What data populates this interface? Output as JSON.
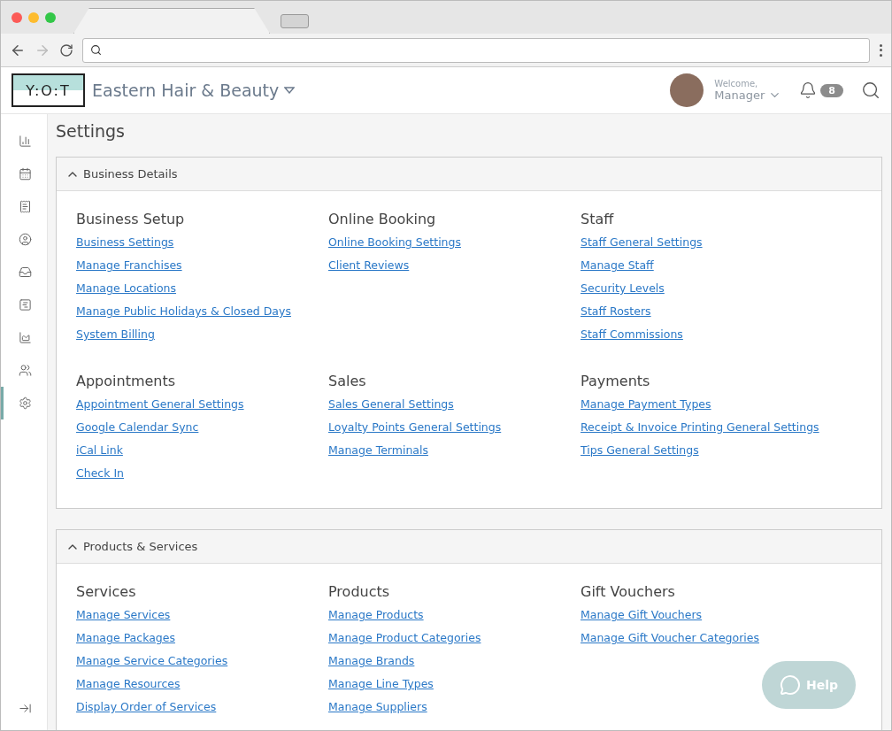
{
  "header": {
    "logo": "Y:O:T",
    "business": "Eastern Hair & Beauty",
    "welcome": "Welcome,",
    "user": "Manager",
    "notifications": "8"
  },
  "sidebar": {
    "items": [
      {
        "selected": false
      },
      {
        "selected": false
      },
      {
        "selected": false
      },
      {
        "selected": false
      },
      {
        "selected": false
      },
      {
        "selected": false
      },
      {
        "selected": false
      },
      {
        "selected": false
      },
      {
        "selected": true
      }
    ]
  },
  "page_title": "Settings",
  "sections": [
    {
      "title": "Business Details",
      "expanded": true,
      "groups": [
        {
          "heading": "Business Setup",
          "links": [
            "Business Settings",
            "Manage Franchises",
            "Manage Locations",
            "Manage Public Holidays & Closed Days",
            "System Billing"
          ]
        },
        {
          "heading": "Online Booking",
          "links": [
            "Online Booking Settings",
            "Client Reviews"
          ]
        },
        {
          "heading": "Staff",
          "links": [
            "Staff General Settings",
            "Manage Staff",
            "Security Levels",
            "Staff Rosters",
            "Staff Commissions"
          ]
        },
        {
          "heading": "Appointments",
          "links": [
            "Appointment General Settings",
            "Google Calendar Sync",
            "iCal Link",
            "Check In"
          ]
        },
        {
          "heading": "Sales",
          "links": [
            "Sales General Settings",
            "Loyalty Points General Settings",
            "Manage Terminals"
          ]
        },
        {
          "heading": "Payments",
          "links": [
            "Manage Payment Types",
            "Receipt & Invoice Printing General Settings",
            "Tips General Settings"
          ]
        }
      ]
    },
    {
      "title": "Products & Services",
      "expanded": true,
      "groups": [
        {
          "heading": "Services",
          "links": [
            "Manage Services",
            "Manage Packages",
            "Manage Service Categories",
            "Manage Resources",
            "Display Order of Services"
          ]
        },
        {
          "heading": "Products",
          "links": [
            "Manage Products",
            "Manage Product Categories",
            "Manage Brands",
            "Manage Line Types",
            "Manage Suppliers"
          ]
        },
        {
          "heading": "Gift Vouchers",
          "links": [
            "Manage Gift Vouchers",
            "Manage Gift Voucher Categories"
          ]
        }
      ]
    }
  ],
  "help": "Help"
}
